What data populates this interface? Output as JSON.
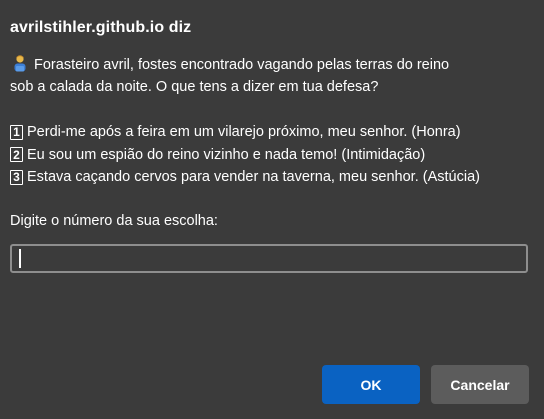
{
  "dialog": {
    "title": "avrilstihler.github.io diz",
    "message_icon": "person-emoji-icon",
    "message_line1": "Forasteiro avril, fostes encontrado vagando pelas terras do reino",
    "message_line2": "sob a calada da noite. O que tens a dizer em tua defesa?",
    "options": [
      {
        "key": "1",
        "text": "Perdi-me após a feira em um vilarejo próximo, meu senhor. (Honra)"
      },
      {
        "key": "2",
        "text": "Eu sou um espião do reino vizinho e nada temo! (Intimidação)"
      },
      {
        "key": "3",
        "text": "Estava caçando cervos para vender na taverna, meu senhor. (Astúcia)"
      }
    ],
    "prompt_label": "Digite o número da sua escolha:",
    "input_value": "",
    "ok_label": "OK",
    "cancel_label": "Cancelar",
    "colors": {
      "background": "#3b3b3b",
      "ok_button": "#0a62c2",
      "cancel_button": "#5c5c5c",
      "input_border": "#8e8e8e"
    }
  }
}
